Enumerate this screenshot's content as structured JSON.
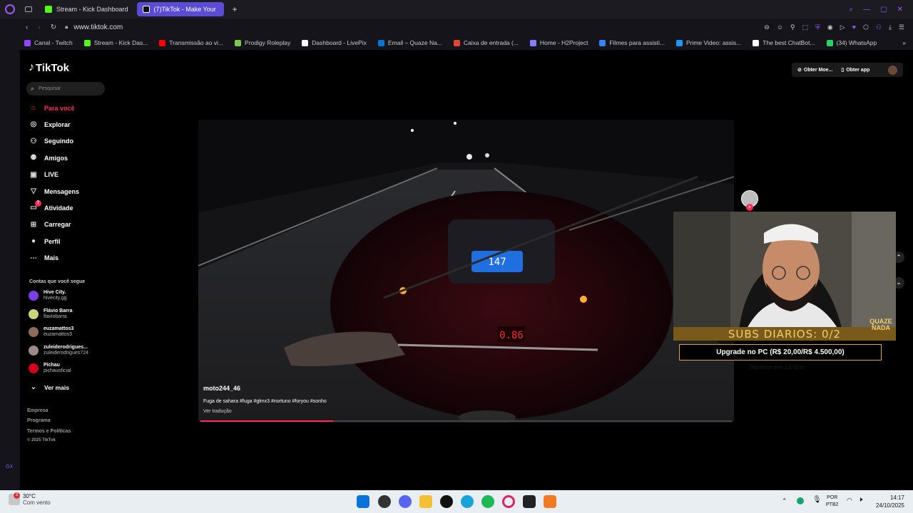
{
  "browser": {
    "tabs": [
      {
        "label": "Stream - Kick Dashboard",
        "active": false,
        "favicon_color": "#53fc18"
      },
      {
        "label": "(7)TikTok - Make Your",
        "active": true,
        "favicon_color": "#000000"
      }
    ],
    "new_tab_icon": "+",
    "url": "www.tiktok.com",
    "bookmarks": [
      {
        "label": "Canal - Twitch",
        "color": "#9146ff"
      },
      {
        "label": "Stream - Kick Das...",
        "color": "#53fc18"
      },
      {
        "label": "Transmissão ao vi...",
        "color": "#ff0000"
      },
      {
        "label": "Prodigy Roleplay",
        "color": "#7ec850"
      },
      {
        "label": "Dashboard - LivePix",
        "color": "#ffffff"
      },
      {
        "label": "Email – Quaze Na...",
        "color": "#0078d4"
      },
      {
        "label": "Caixa de entrada (...",
        "color": "#ea4335"
      },
      {
        "label": "Home - H2Project",
        "color": "#8a7cff"
      },
      {
        "label": "Filmes para assisti...",
        "color": "#3b82f6"
      },
      {
        "label": "Prime Video: assis...",
        "color": "#1a98ff"
      },
      {
        "label": "The best ChatBot...",
        "color": "#ffffff"
      },
      {
        "label": "(34) WhatsApp",
        "color": "#25d366"
      }
    ]
  },
  "tiktok": {
    "logo": "TikTok",
    "search_placeholder": "Pesquisar",
    "nav": [
      {
        "label": "Para você",
        "icon": "home-icon",
        "active": true
      },
      {
        "label": "Explorar",
        "icon": "compass-icon"
      },
      {
        "label": "Seguindo",
        "icon": "following-icon"
      },
      {
        "label": "Amigos",
        "icon": "friends-icon"
      },
      {
        "label": "LIVE",
        "icon": "live-icon"
      },
      {
        "label": "Mensagens",
        "icon": "messages-icon"
      },
      {
        "label": "Atividade",
        "icon": "activity-icon",
        "badge": "7"
      },
      {
        "label": "Carregar",
        "icon": "upload-icon"
      },
      {
        "label": "Perfil",
        "icon": "profile-icon"
      },
      {
        "label": "Mais",
        "icon": "more-icon"
      }
    ],
    "following_title": "Contas que você segue",
    "following": [
      {
        "name": "Hive City.",
        "handle": "hivecity.gg",
        "color": "#7b3fe4"
      },
      {
        "name": "Flávio Barra",
        "handle": "flaviobarra",
        "color": "#c8d37a"
      },
      {
        "name": "euzamattos3",
        "handle": "euzamattos3",
        "color": "#8b6b5a"
      },
      {
        "name": "zuleiderodrigues...",
        "handle": "zuleiderodrigues724",
        "color": "#9a8a8a"
      },
      {
        "name": "Pichau",
        "handle": "pichauoficial",
        "color": "#d0021b"
      }
    ],
    "see_more": "Ver mais",
    "footer": [
      "Empresa",
      "Programa",
      "Termos e Políticas",
      "© 2025 TikTok"
    ],
    "top_buttons": {
      "coins": "Obter Moe...",
      "app": "Obter app"
    },
    "video": {
      "author": "moto244_46",
      "caption": "Fuga de sahara #fuga #glmx3 #nortuno #foryou #sonho",
      "translate": "Ver tradução",
      "progress": 0.25,
      "dash_speed": "147",
      "dash_gear": "0.86"
    }
  },
  "overlay": {
    "subs_text": "SUBS DIARIOS: 0/2",
    "brand": "QUAZE NADA",
    "upgrade_text": "Upgrade no PC (R$ 20,00/R$ 4.500,00)",
    "ghost_text": "Termina em 13 dias"
  },
  "taskbar": {
    "weather_temp": "30°C",
    "weather_desc": "Com vento",
    "weather_badge": "3",
    "lang": "POR",
    "kbd": "PTB2",
    "time": "14:17",
    "date": "24/10/2025"
  }
}
